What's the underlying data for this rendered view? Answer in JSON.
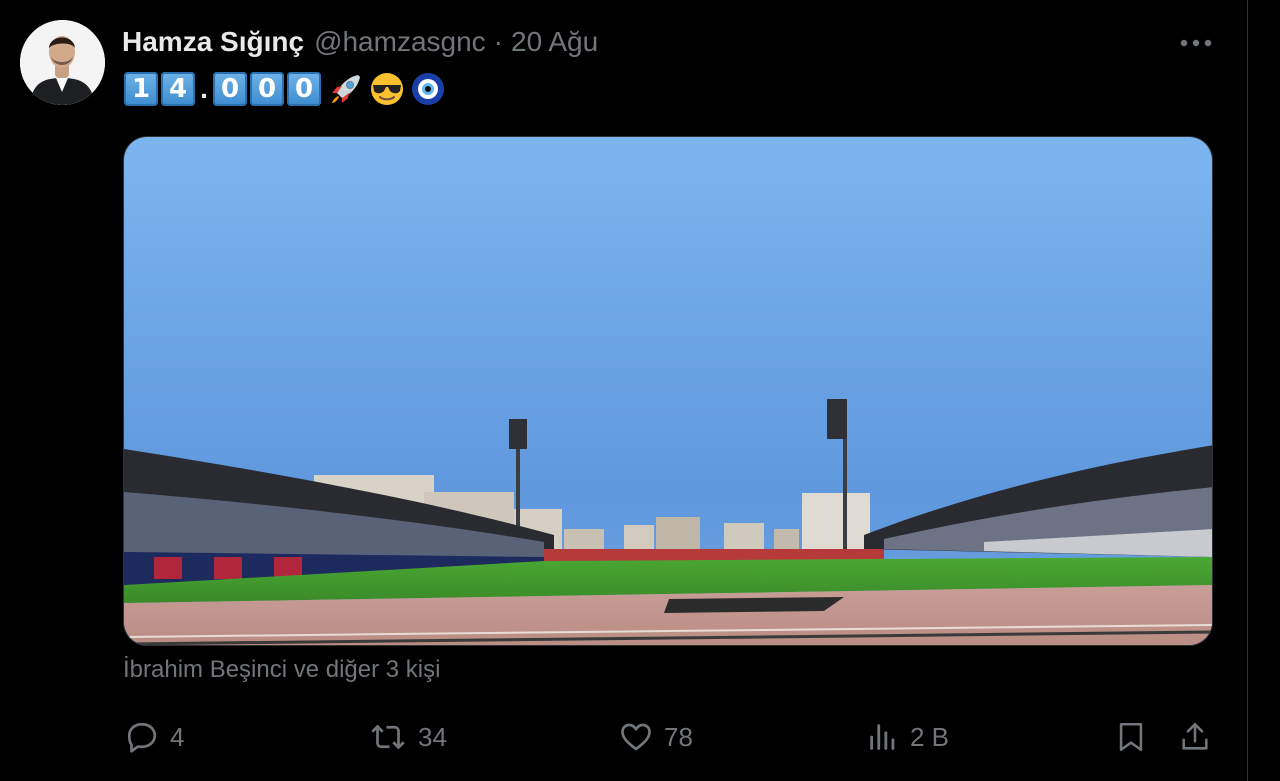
{
  "tweet": {
    "author_name": "Hamza Sığınç",
    "handle": "@hamzasgnc",
    "separator": "·",
    "timestamp": "20 Ağu",
    "text": {
      "digits_before": [
        "1",
        "4"
      ],
      "period": ".",
      "digits_after": [
        "0",
        "0",
        "0"
      ],
      "emojis": [
        "rocket-emoji",
        "sunglasses-emoji",
        "nazar-amulet-emoji"
      ]
    },
    "tagged": "İbrahim Beşinci ve diğer 3 kişi",
    "actions": {
      "reply_count": "4",
      "retweet_count": "34",
      "like_count": "78",
      "views_count": "2 B"
    }
  },
  "icons": {
    "more": "more-horizontal-icon",
    "reply": "reply-icon",
    "retweet": "retweet-icon",
    "like": "heart-icon",
    "views": "views-icon",
    "bookmark": "bookmark-icon",
    "share": "share-icon"
  },
  "colors": {
    "background": "#000000",
    "text_primary": "#e7e9ea",
    "text_secondary": "#71767b",
    "keycap_blue": "#3d8bd0",
    "sky_blue": "#7ab2ea",
    "pitch_green": "#3f9a2c"
  }
}
